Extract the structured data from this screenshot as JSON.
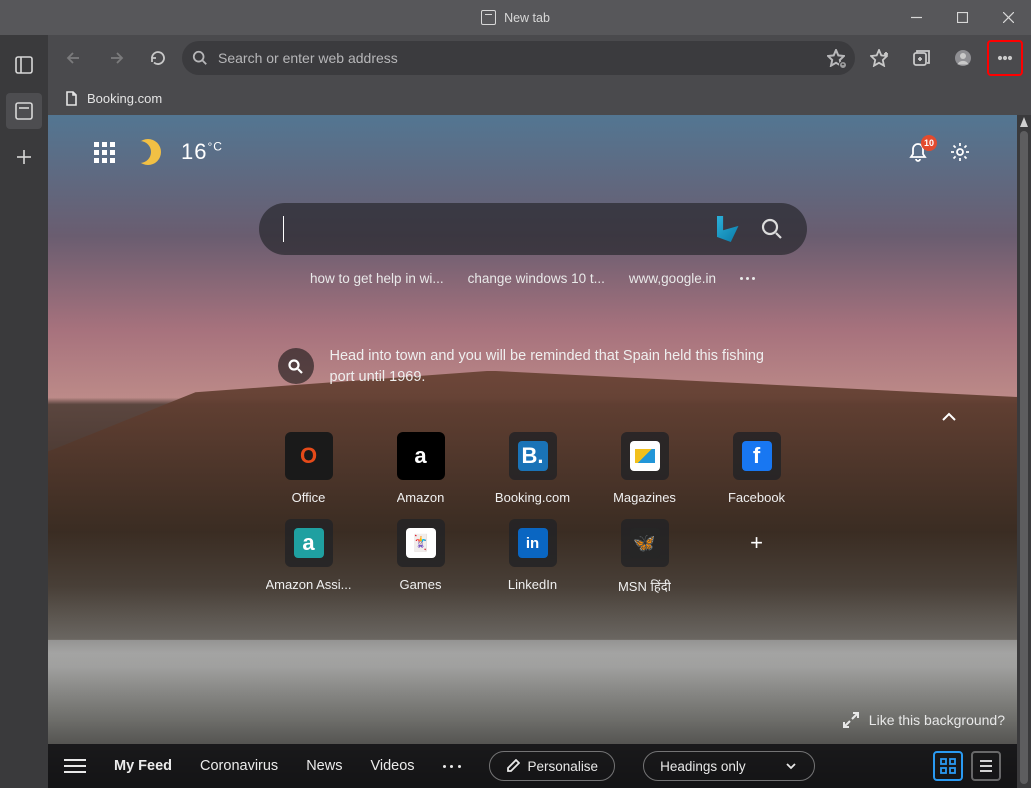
{
  "window": {
    "title": "New tab"
  },
  "address_bar": {
    "placeholder": "Search or enter web address"
  },
  "toolbar": {},
  "tab": {
    "label": "Booking.com"
  },
  "header": {
    "temperature": "16",
    "temp_unit": "°C",
    "notifications": "10"
  },
  "search": {
    "placeholder": ""
  },
  "suggestions": [
    "how to get help in wi...",
    "change windows 10 t...",
    "www,google.in"
  ],
  "hint": {
    "text": "Head into town and you will be reminded that Spain held this fishing port until 1969."
  },
  "tiles": [
    {
      "label": "Office",
      "icon": "O",
      "klass": "ic-office"
    },
    {
      "label": "Amazon",
      "icon": "",
      "klass": "ic-amazon"
    },
    {
      "label": "Booking.com",
      "icon": "B.",
      "klass": "ic-booking",
      "wrap": true
    },
    {
      "label": "Magazines",
      "icon": "",
      "klass": "ic-mag",
      "wrap": true
    },
    {
      "label": "Facebook",
      "icon": "f",
      "klass": "ic-fb",
      "wrap": true
    },
    {
      "label": "Amazon Assi...",
      "icon": "a",
      "klass": "ic-assi",
      "wrap": true
    },
    {
      "label": "Games",
      "icon": "🃏",
      "klass": "ic-games",
      "wrap": true
    },
    {
      "label": "LinkedIn",
      "icon": "in",
      "klass": "ic-linkedin",
      "wrap": true
    },
    {
      "label": "MSN हिंदी",
      "icon": "🦋",
      "klass": "ic-msn",
      "wrap": true
    }
  ],
  "like_bg": {
    "label": "Like this background?"
  },
  "feed": {
    "tabs": [
      "My Feed",
      "Coronavirus",
      "News",
      "Videos"
    ],
    "personalise": "Personalise",
    "headings": "Headings only"
  }
}
